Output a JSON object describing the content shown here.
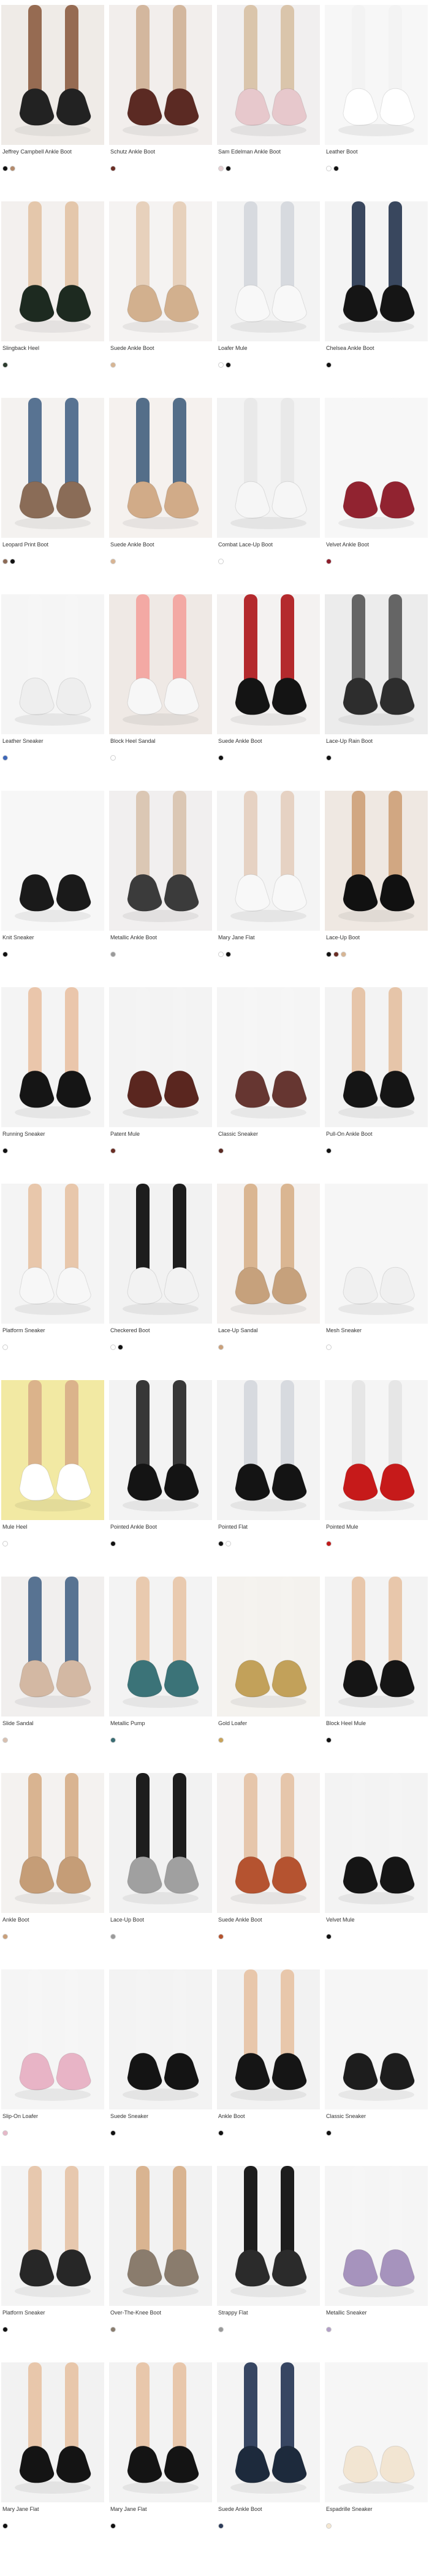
{
  "products": [
    {
      "name": "Jeffrey Campbell Ankle Boot",
      "price": "",
      "sale_price": "",
      "colors": [
        "#111111",
        "#b48a6b"
      ],
      "note": "",
      "bg": "#efeae6",
      "shoe": "#151515",
      "leg": "#8a5b3f"
    },
    {
      "name": "Schutz Ankle Boot",
      "price": "",
      "sale_price": "",
      "colors": [
        "#6a2d24"
      ],
      "note": "",
      "bg": "#f2eeec",
      "shoe": "#5b2a23",
      "leg": "#d1b39a"
    },
    {
      "name": "Sam Edelman Ankle Boot",
      "price": "",
      "sale_price": "",
      "colors": [
        "#e6cfd2",
        "#111111"
      ],
      "note": "",
      "bg": "#f1efef",
      "shoe": "#e7c8cc",
      "leg": "#d8c2a7"
    },
    {
      "name": "Leather Boot",
      "price": "",
      "sale_price": "",
      "colors": [
        "#ffffff",
        "#111111"
      ],
      "note": "",
      "bg": "#f7f7f7",
      "shoe": "#ffffff",
      "leg": "#f2f2f2"
    },
    {
      "name": "Slingback Heel",
      "price": "",
      "sale_price": "",
      "colors": [
        "#2b3b2d"
      ],
      "note": "",
      "bg": "#f3f0ee",
      "shoe": "#1d2a20",
      "leg": "#e3c4a6"
    },
    {
      "name": "Suede Ankle Boot",
      "price": "",
      "sale_price": "",
      "colors": [
        "#d7b593"
      ],
      "note": "",
      "bg": "#f5f3f2",
      "shoe": "#d2b08e",
      "leg": "#e6cfb8"
    },
    {
      "name": "Loafer Mule",
      "price": "",
      "sale_price": "",
      "colors": [
        "#ffffff",
        "#111111"
      ],
      "note": "",
      "bg": "#f3f3f3",
      "shoe": "#f8f8f8",
      "leg": "#d5d8dd"
    },
    {
      "name": "Chelsea Ankle Boot",
      "price": "",
      "sale_price": "",
      "colors": [
        "#111111"
      ],
      "note": "",
      "bg": "#f4f4f4",
      "shoe": "#151515",
      "leg": "#2e3d55"
    },
    {
      "name": "Leopard Print Boot",
      "price": "",
      "sale_price": "",
      "colors": [
        "#8c6a55",
        "#111111"
      ],
      "note": "",
      "bg": "#f4f2f0",
      "shoe": "#8a6c57",
      "leg": "#4f6b8c"
    },
    {
      "name": "Suede Ankle Boot",
      "price": "",
      "sale_price": "",
      "colors": [
        "#d8b493"
      ],
      "note": "",
      "bg": "#f5f1ee",
      "shoe": "#d1ab88",
      "leg": "#4b6683"
    },
    {
      "name": "Combat Lace-Up Boot",
      "price": "",
      "sale_price": "",
      "colors": [
        "#ffffff"
      ],
      "note": "",
      "bg": "#f3f3f3",
      "shoe": "#f6f6f6",
      "leg": "#e8e8e8"
    },
    {
      "name": "Velvet Ankle Boot",
      "price": "",
      "sale_price": "",
      "colors": [
        "#8c1c2a"
      ],
      "note": "",
      "bg": "#f7f7f7",
      "shoe": "#8b1624",
      "leg": "#f7f7f7"
    },
    {
      "name": "Leather Sneaker",
      "price": "",
      "sale_price": "",
      "colors": [
        "#3d67b8"
      ],
      "note": "",
      "bg": "#f5f5f5",
      "shoe": "#eeeeee",
      "leg": "#f5f5f5"
    },
    {
      "name": "Block Heel Sandal",
      "price": "",
      "sale_price": "",
      "colors": [
        "#ffffff"
      ],
      "note": "",
      "bg": "#efe9e5",
      "shoe": "#f7f7f7",
      "leg": "#f2a5a0"
    },
    {
      "name": "Suede Ankle Boot",
      "price": "",
      "sale_price": "",
      "colors": [
        "#111111"
      ],
      "note": "",
      "bg": "#f4f2f1",
      "shoe": "#141414",
      "leg": "#b01f22"
    },
    {
      "name": "Lace-Up Rain Boot",
      "price": "",
      "sale_price": "",
      "colors": [
        "#111111"
      ],
      "note": "",
      "bg": "#ececec",
      "shoe": "#2d2d2d",
      "leg": "#5e5e5e"
    },
    {
      "name": "Knit Sneaker",
      "price": "",
      "sale_price": "",
      "colors": [
        "#111111"
      ],
      "note": "",
      "bg": "#f7f7f7",
      "shoe": "#1a1a1a",
      "leg": "#f7f7f7"
    },
    {
      "name": "Metallic Ankle Boot",
      "price": "",
      "sale_price": "",
      "colors": [
        "#9a9a9a"
      ],
      "note": "",
      "bg": "#f1efef",
      "shoe": "#3b3b3b",
      "leg": "#d9c4b0"
    },
    {
      "name": "Mary Jane Flat",
      "price": "",
      "sale_price": "",
      "colors": [
        "#ffffff",
        "#111111"
      ],
      "note": "",
      "bg": "#f4f4f4",
      "shoe": "#f8f8f8",
      "leg": "#e5d0c0"
    },
    {
      "name": "Lace-Up Boot",
      "price": "",
      "sale_price": "",
      "colors": [
        "#111111",
        "#6a2d24",
        "#d7b593"
      ],
      "note": "",
      "bg": "#efe8e2",
      "shoe": "#111111",
      "leg": "#cfa37c"
    },
    {
      "name": "Running Sneaker",
      "price": "",
      "sale_price": "",
      "colors": [
        "#111111"
      ],
      "note": "",
      "bg": "#f4f4f4",
      "shoe": "#151515",
      "leg": "#e9c3a6"
    },
    {
      "name": "Patent Mule",
      "price": "",
      "sale_price": "",
      "colors": [
        "#6a2d24"
      ],
      "note": "",
      "bg": "#f3f3f3",
      "shoe": "#5a261f",
      "leg": "#f3f3f3"
    },
    {
      "name": "Classic Sneaker",
      "price": "",
      "sale_price": "",
      "colors": [
        "#5b2a23"
      ],
      "note": "",
      "bg": "#f5f5f5",
      "shoe": "#5d2a25",
      "leg": "#f5f5f5"
    },
    {
      "name": "Pull-On Ankle Boot",
      "price": "",
      "sale_price": "",
      "colors": [
        "#111111"
      ],
      "note": "",
      "bg": "#f3f3f3",
      "shoe": "#151515",
      "leg": "#e5c2a4"
    },
    {
      "name": "Platform Sneaker",
      "price": "",
      "sale_price": "",
      "colors": [
        "#ffffff"
      ],
      "note": "",
      "bg": "#f4f4f4",
      "shoe": "#f7f7f7",
      "leg": "#e7c4a6"
    },
    {
      "name": "Checkered Boot",
      "price": "",
      "sale_price": "",
      "colors": [
        "#ffffff",
        "#111111"
      ],
      "note": "",
      "bg": "#f2f2f2",
      "shoe": "#f2f2f2",
      "leg": "#111111"
    },
    {
      "name": "Lace-Up Sandal",
      "price": "",
      "sale_price": "",
      "colors": [
        "#caa07a"
      ],
      "note": "",
      "bg": "#f4f1ef",
      "shoe": "#c6a17c",
      "leg": "#d8b28c"
    },
    {
      "name": "Mesh Sneaker",
      "price": "",
      "sale_price": "",
      "colors": [
        "#ffffff"
      ],
      "note": "",
      "bg": "#f6f6f6",
      "shoe": "#f0f0f0",
      "leg": "#f6f6f6"
    },
    {
      "name": "Mule Heel",
      "price": "",
      "sale_price": "",
      "colors": [
        "#ffffff"
      ],
      "note": "",
      "bg": "#f2e9a3",
      "shoe": "#ffffff",
      "leg": "#d9b08a"
    },
    {
      "name": "Pointed Ankle Boot",
      "price": "",
      "sale_price": "",
      "colors": [
        "#111111"
      ],
      "note": "",
      "bg": "#f3f3f3",
      "shoe": "#141414",
      "leg": "#2c2c2c"
    },
    {
      "name": "Pointed Flat",
      "price": "",
      "sale_price": "",
      "colors": [
        "#111111",
        "#ffffff"
      ],
      "note": "",
      "bg": "#f3f3f3",
      "shoe": "#141414",
      "leg": "#d5d8dd"
    },
    {
      "name": "Pointed Mule",
      "price": "",
      "sale_price": "",
      "colors": [
        "#c01a1a"
      ],
      "note": "",
      "bg": "#f5f5f5",
      "shoe": "#c61a1a",
      "leg": "#e5e5e5"
    },
    {
      "name": "Slide Sandal",
      "price": "",
      "sale_price": "",
      "colors": [
        "#d8c0b0"
      ],
      "note": "",
      "bg": "#f1efee",
      "shoe": "#d3b8a3",
      "leg": "#4f6b8c"
    },
    {
      "name": "Metallic Pump",
      "price": "",
      "sale_price": "",
      "colors": [
        "#3a6d73"
      ],
      "note": "",
      "bg": "#f3f3f3",
      "shoe": "#2f6b70",
      "leg": "#e7c4a6"
    },
    {
      "name": "Gold Loafer",
      "price": "",
      "sale_price": "",
      "colors": [
        "#c8a35a"
      ],
      "note": "",
      "bg": "#f4f2ee",
      "shoe": "#c2a15a",
      "leg": "#f4f2ee"
    },
    {
      "name": "Block Heel Mule",
      "price": "",
      "sale_price": "",
      "colors": [
        "#111111"
      ],
      "note": "",
      "bg": "#f3f3f3",
      "shoe": "#151515",
      "leg": "#e7c4a6"
    },
    {
      "name": "Ankle Boot",
      "price": "",
      "sale_price": "",
      "colors": [
        "#caa07a"
      ],
      "note": "",
      "bg": "#f4f2f0",
      "shoe": "#c59d77",
      "leg": "#d7b08b"
    },
    {
      "name": "Lace-Up Boot",
      "price": "",
      "sale_price": "",
      "colors": [
        "#9a9a9a"
      ],
      "note": "",
      "bg": "#f2f2f2",
      "shoe": "#a0a0a0",
      "leg": "#111111"
    },
    {
      "name": "Suede Ankle Boot",
      "price": "",
      "sale_price": "",
      "colors": [
        "#b5532d"
      ],
      "note": "",
      "bg": "#f4f2f1",
      "shoe": "#b55330",
      "leg": "#e5c3a6"
    },
    {
      "name": "Velvet Mule",
      "price": "",
      "sale_price": "",
      "colors": [
        "#111111"
      ],
      "note": "",
      "bg": "#f3f3f3",
      "shoe": "#151515",
      "leg": "#f3f3f3"
    },
    {
      "name": "Slip-On Loafer",
      "price": "",
      "sale_price": "",
      "colors": [
        "#e6b8c8"
      ],
      "note": "",
      "bg": "#f5f5f5",
      "shoe": "#e8b4c6",
      "leg": "#f5f5f5"
    },
    {
      "name": "Suede Sneaker",
      "price": "",
      "sale_price": "",
      "colors": [
        "#111111"
      ],
      "note": "",
      "bg": "#f3f3f3",
      "shoe": "#141414",
      "leg": "#f3f3f3"
    },
    {
      "name": "Ankle Boot",
      "price": "",
      "sale_price": "",
      "colors": [
        "#111111"
      ],
      "note": "",
      "bg": "#f2f2f2",
      "shoe": "#151515",
      "leg": "#e7c4a6"
    },
    {
      "name": "Classic Sneaker",
      "price": "",
      "sale_price": "",
      "colors": [
        "#111111"
      ],
      "note": "",
      "bg": "#f6f6f6",
      "shoe": "#1d1d1d",
      "leg": "#f6f6f6"
    },
    {
      "name": "Platform Sneaker",
      "price": "",
      "sale_price": "",
      "colors": [
        "#111111"
      ],
      "note": "",
      "bg": "#f4f4f4",
      "shoe": "#1a1a1a",
      "leg": "#e5c2a4"
    },
    {
      "name": "Over-The-Knee Boot",
      "price": "",
      "sale_price": "",
      "colors": [
        "#8a7d6e"
      ],
      "note": "",
      "bg": "#f2f2f2",
      "shoe": "#8a7c6d",
      "leg": "#d7b08b"
    },
    {
      "name": "Strappy Flat",
      "price": "",
      "sale_price": "",
      "colors": [
        "#9a9a9a"
      ],
      "note": "",
      "bg": "#f4f4f4",
      "shoe": "#2b2b2b",
      "leg": "#111111"
    },
    {
      "name": "Metallic Sneaker",
      "price": "",
      "sale_price": "",
      "colors": [
        "#b2a0c6"
      ],
      "note": "",
      "bg": "#f5f5f5",
      "shoe": "#a693bd",
      "leg": "#f5f5f5"
    },
    {
      "name": "Mary Jane Flat",
      "price": "",
      "sale_price": "",
      "colors": [
        "#111111"
      ],
      "note": "",
      "bg": "#f2f2f2",
      "shoe": "#141414",
      "leg": "#e7c4a6"
    },
    {
      "name": "Mary Jane Flat",
      "price": "",
      "sale_price": "",
      "colors": [
        "#111111"
      ],
      "note": "",
      "bg": "#f3f3f3",
      "shoe": "#141414",
      "leg": "#e7c4a6"
    },
    {
      "name": "Suede Ankle Boot",
      "price": "",
      "sale_price": "",
      "colors": [
        "#2c3c5a"
      ],
      "note": "",
      "bg": "#f4f4f4",
      "shoe": "#1d2a3c",
      "leg": "#2c3c5a"
    },
    {
      "name": "Espadrille Sneaker",
      "price": "",
      "sale_price": "",
      "colors": [
        "#f5e7d1"
      ],
      "note": "",
      "bg": "#f6f6f6",
      "shoe": "#f2e5d2",
      "leg": "#f6f6f6"
    }
  ]
}
